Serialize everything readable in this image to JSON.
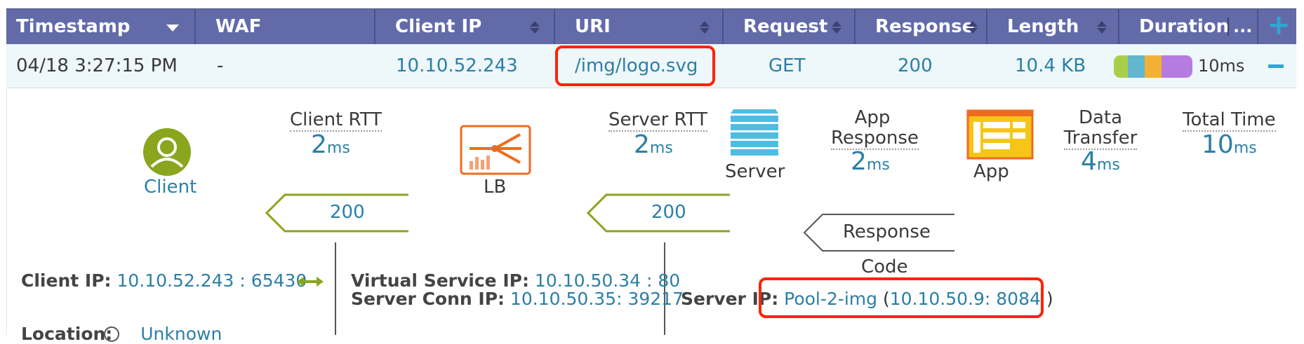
{
  "header": {
    "columns": [
      {
        "label": "Timestamp"
      },
      {
        "label": "WAF"
      },
      {
        "label": "Client IP"
      },
      {
        "label": "URI"
      },
      {
        "label": "Request"
      },
      {
        "label": "Response"
      },
      {
        "label": "Length"
      },
      {
        "label": "Duration"
      }
    ],
    "duration_more": "...",
    "add_symbol": "+"
  },
  "row": {
    "timestamp": "04/18 3:27:15 PM",
    "waf": "-",
    "client_ip": "10.10.52.243",
    "uri": "/img/logo.svg",
    "request": "GET",
    "response": "200",
    "length": "10.4 KB",
    "duration": "10ms",
    "duration_colors": [
      "#a9cf4a",
      "#63b6d0",
      "#f2b134",
      "#b57be0"
    ],
    "collapse_symbol": "−"
  },
  "detail": {
    "client_label": "Client",
    "lb_label": "LB",
    "server_label": "Server",
    "app_label": "App",
    "client_rtt": {
      "title": "Client RTT",
      "value": "2",
      "unit": "ms"
    },
    "server_rtt": {
      "title": "Server RTT",
      "value": "2",
      "unit": "ms"
    },
    "app_response": {
      "title_line1": "App",
      "title_line2": "Response",
      "value": "2",
      "unit": "ms"
    },
    "data_transfer": {
      "title_line1": "Data",
      "title_line2": "Transfer",
      "value": "4",
      "unit": "ms"
    },
    "total_time": {
      "title": "Total Time",
      "value": "10",
      "unit": "ms"
    },
    "client_response_code": "200",
    "server_response_code": "200",
    "response_label": "Response",
    "code_label": "Code",
    "client_ip_label": "Client IP:",
    "client_ip_value": "10.10.52.243",
    "client_port": ": 65430",
    "vs_ip_label": "Virtual Service IP:",
    "vs_ip_value": "10.10.50.34",
    "vs_port": ": 80",
    "conn_ip_label": "Server Conn IP:",
    "conn_ip_value": "10.10.50.35",
    "conn_port": ": 39217",
    "server_ip_label": "Server IP:",
    "server_pool": "Pool-2-img",
    "server_ip_value": "10.10.50.9",
    "server_port": ": 8084",
    "server_paren_open": "(",
    "server_paren_close": ")",
    "location_label": "Location:",
    "location_value": "Unknown"
  },
  "colors": {
    "header_bg": "#626ba8",
    "row_bg": "#eef7fa",
    "link": "#2b7fa6",
    "accent_green": "#8aa51e",
    "lb_orange": "#f06a20",
    "server_blue": "#4dbde3",
    "app_yellow": "#f5c518",
    "highlight_red": "#ff2200"
  },
  "icons": [
    "sort-icon",
    "sort-desc-icon",
    "add-column-icon",
    "collapse-icon",
    "client-user-icon",
    "load-balancer-icon",
    "server-stack-icon",
    "app-window-icon",
    "bidirectional-arrow-icon",
    "info-icon"
  ]
}
